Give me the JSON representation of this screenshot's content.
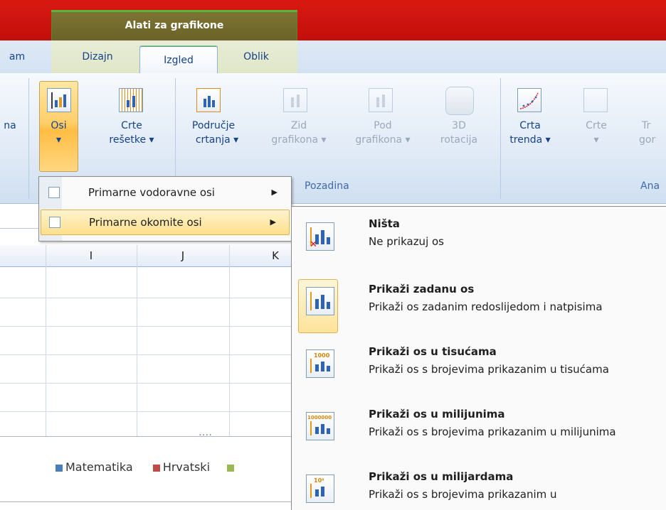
{
  "ribbon": {
    "contextual_group": "Alati za grafikone",
    "tabs": {
      "left_partial": "am",
      "dizajn": "Dizajn",
      "izgled": "Izgled",
      "oblik": "Oblik"
    },
    "buttons": {
      "partial_left": "na",
      "osi": "Osi",
      "osi_arrow": "▾",
      "crte_resetke_line1": "Crte",
      "crte_resetke_line2": "rešetke ▾",
      "podrucje_line1": "Područje",
      "podrucje_line2": "crtanja ▾",
      "zid_line1": "Zid",
      "zid_line2": "grafikona ▾",
      "pod_line1": "Pod",
      "pod_line2": "grafikona ▾",
      "rot_line1": "3D",
      "rot_line2": "rotacija",
      "crta_trenda_line1": "Crta",
      "crta_trenda_line2": "trenda ▾",
      "crte_line1": "Crte",
      "crte_line2": "▾",
      "partial_right_line1": "Tr",
      "partial_right_line2": "gor"
    },
    "group_labels": {
      "pozadina": "Pozadina",
      "analiza_partial": "Ana"
    }
  },
  "menu": {
    "items": [
      {
        "label": "Primarne vodoravne osi",
        "arrow": "▶"
      },
      {
        "label": "Primarne okomite osi",
        "arrow": "▶"
      }
    ]
  },
  "submenu": {
    "items": [
      {
        "title": "Ništa",
        "desc": "Ne prikazuj os"
      },
      {
        "title": "Prikaži zadanu os",
        "desc": "Prikaži os zadanim redoslijedom i natpisima"
      },
      {
        "title": "Prikaži os u tisućama",
        "desc": "Prikaži os s brojevima prikazanim u tisućama",
        "icon_label": "1000"
      },
      {
        "title": "Prikaži os u milijunima",
        "desc": "Prikaži os s brojevima prikazanim u milijunima",
        "icon_label": "1000000"
      },
      {
        "title": "Prikaži os u milijardama",
        "desc": "Prikaži os s brojevima prikazanim u",
        "icon_label": "10⁹"
      }
    ]
  },
  "sheet": {
    "columns": [
      "I",
      "J",
      "K"
    ],
    "scroll_grip": "....",
    "legend": [
      {
        "label": "Matematika",
        "color": "#4a7ebb"
      },
      {
        "label": "Hrvatski",
        "color": "#be4b48"
      }
    ]
  },
  "colors": {
    "title_red": "#d81912",
    "context_olive": "#7d7434",
    "accent_green": "#59b23a",
    "selection_orange": "#ffcf6b"
  }
}
